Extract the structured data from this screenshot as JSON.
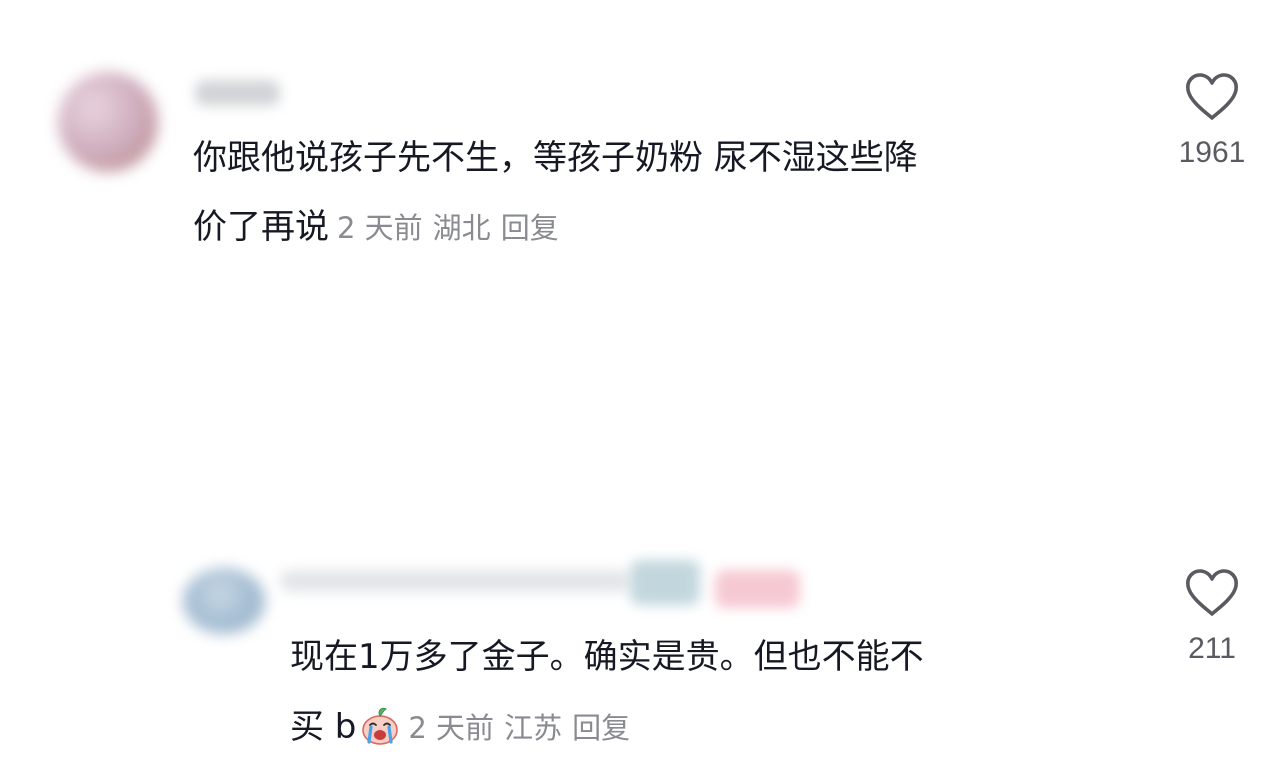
{
  "comments": [
    {
      "line1": "你跟他说孩子先不生，等孩子奶粉 尿不湿这些降",
      "line2": "价了再说",
      "time": "2 天前",
      "location": "湖北",
      "reply_label": "回复",
      "likes": "1961",
      "icon": "heart-outline-icon"
    },
    {
      "line1": "现在1万多了金子。确实是贵。但也不能不",
      "line2": "买 b",
      "emoji": "crying-peach-emoji",
      "time": "2 天前",
      "location": "江苏",
      "reply_label": "回复",
      "likes": "211",
      "icon": "heart-outline-icon"
    }
  ]
}
